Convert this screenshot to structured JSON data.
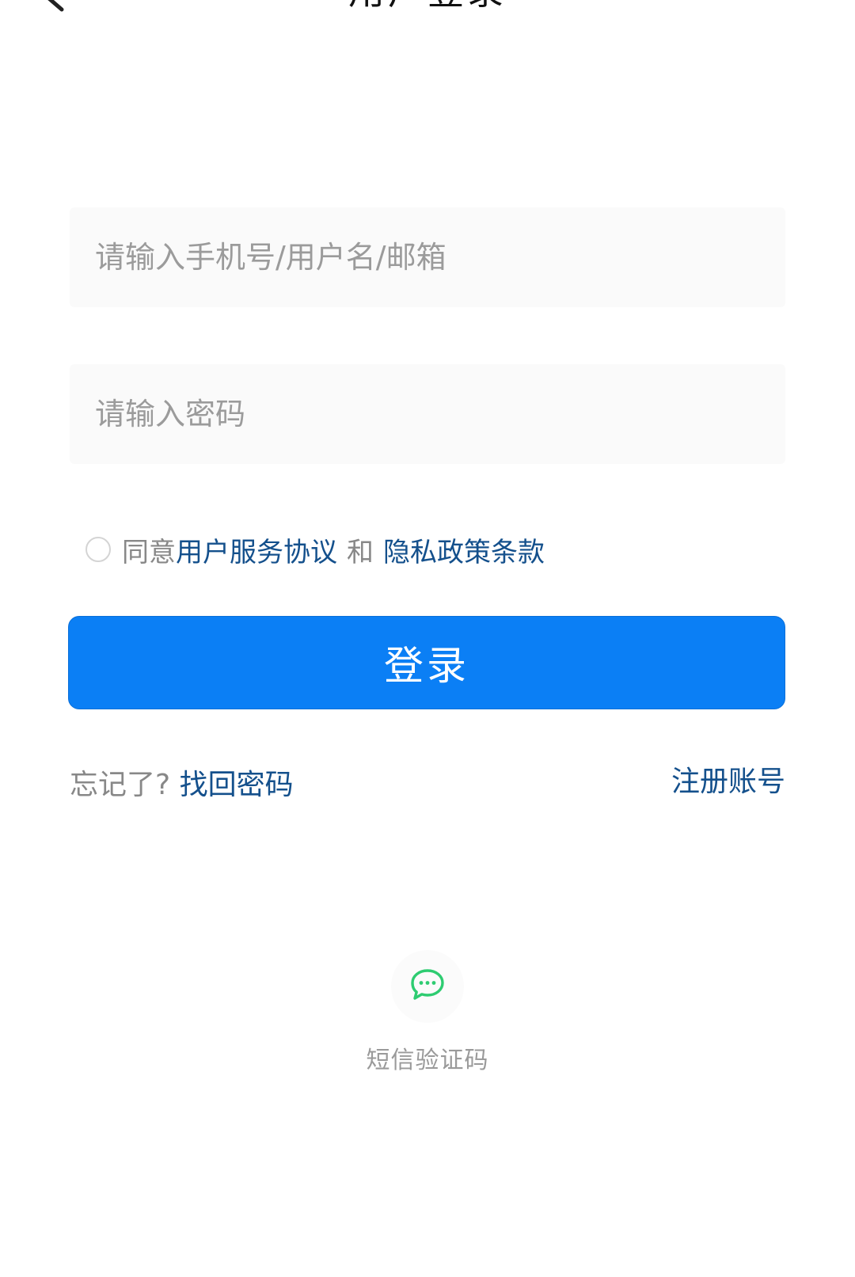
{
  "header": {
    "title": "用户登录",
    "back_icon": "chevron-left-icon"
  },
  "form": {
    "account_placeholder": "请输入手机号/用户名/邮箱",
    "password_placeholder": "请输入密码"
  },
  "agreement": {
    "checked": false,
    "prefix": "同意",
    "terms_link": "用户服务协议",
    "connector": "和",
    "privacy_link": "隐私政策条款"
  },
  "actions": {
    "login_label": "登录",
    "forgot_prefix": "忘记了?",
    "recover_link": "找回密码",
    "register_link": "注册账号"
  },
  "alt_login": {
    "sms_icon": "chat-bubble-icon",
    "sms_label": "短信验证码"
  },
  "colors": {
    "primary": "#0b7ff5",
    "link": "#14508c",
    "muted": "#888888",
    "sms_icon": "#2ecc71"
  }
}
